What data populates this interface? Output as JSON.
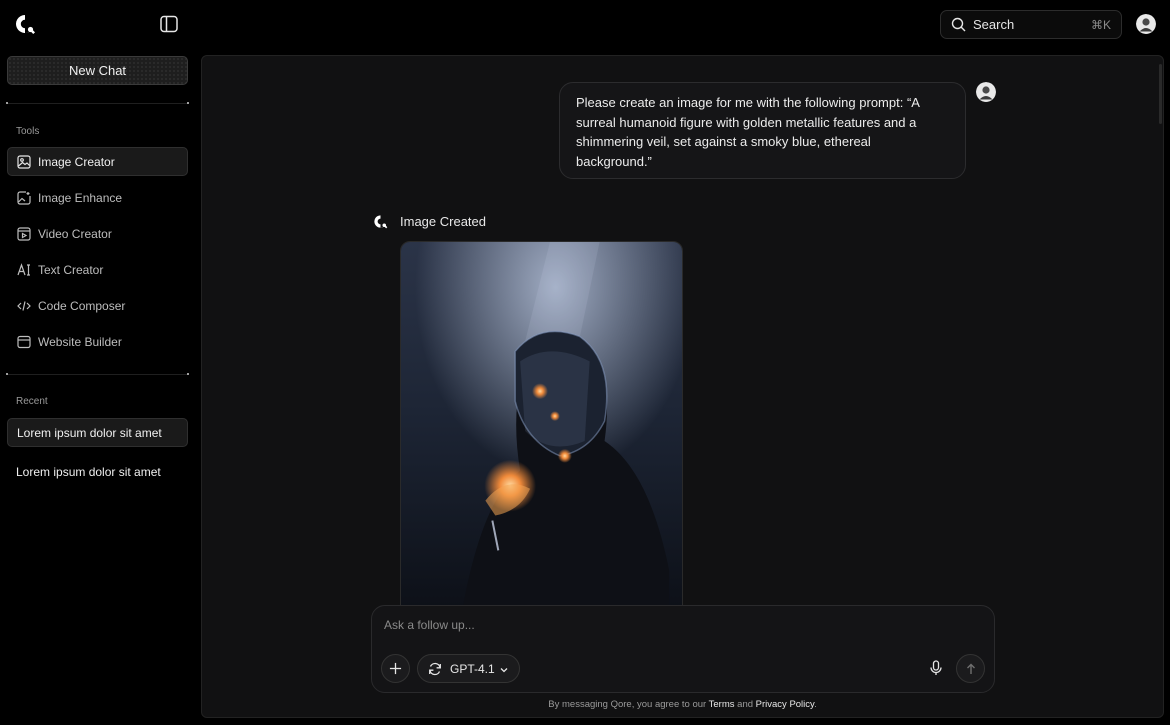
{
  "header": {
    "search_label": "Search",
    "search_shortcut": "⌘K"
  },
  "sidebar": {
    "new_chat_label": "New Chat",
    "tools_label": "Tools",
    "tools": [
      {
        "label": "Image Creator",
        "icon": "image-icon",
        "active": true
      },
      {
        "label": "Image Enhance",
        "icon": "image-enhance-icon",
        "active": false
      },
      {
        "label": "Video Creator",
        "icon": "video-icon",
        "active": false
      },
      {
        "label": "Text Creator",
        "icon": "text-icon",
        "active": false
      },
      {
        "label": "Code Composer",
        "icon": "code-icon",
        "active": false
      },
      {
        "label": "Website Builder",
        "icon": "browser-icon",
        "active": false
      }
    ],
    "recent_label": "Recent",
    "recent": [
      {
        "label": "Lorem ipsum dolor sit amet",
        "active": true
      },
      {
        "label": "Lorem ipsum dolor sit amet",
        "active": false
      }
    ]
  },
  "chat": {
    "user_message": "Please create an image for me with the following prompt: “A surreal humanoid figure with golden metallic features and a shimmering veil, set against a smoky blue, ethereal background.”",
    "response_title": "Image Created"
  },
  "composer": {
    "placeholder": "Ask a follow up...",
    "model": "GPT-4.1"
  },
  "footer": {
    "prefix": "By messaging Qore, you agree to our ",
    "terms": "Terms",
    "and": " and ",
    "privacy": "Privacy Policy",
    "suffix": "."
  },
  "colors": {
    "background": "#000000",
    "panel": "#111112",
    "border": "#2c2c2e",
    "text": "#e8e8e8",
    "muted": "#9a9a9a"
  }
}
